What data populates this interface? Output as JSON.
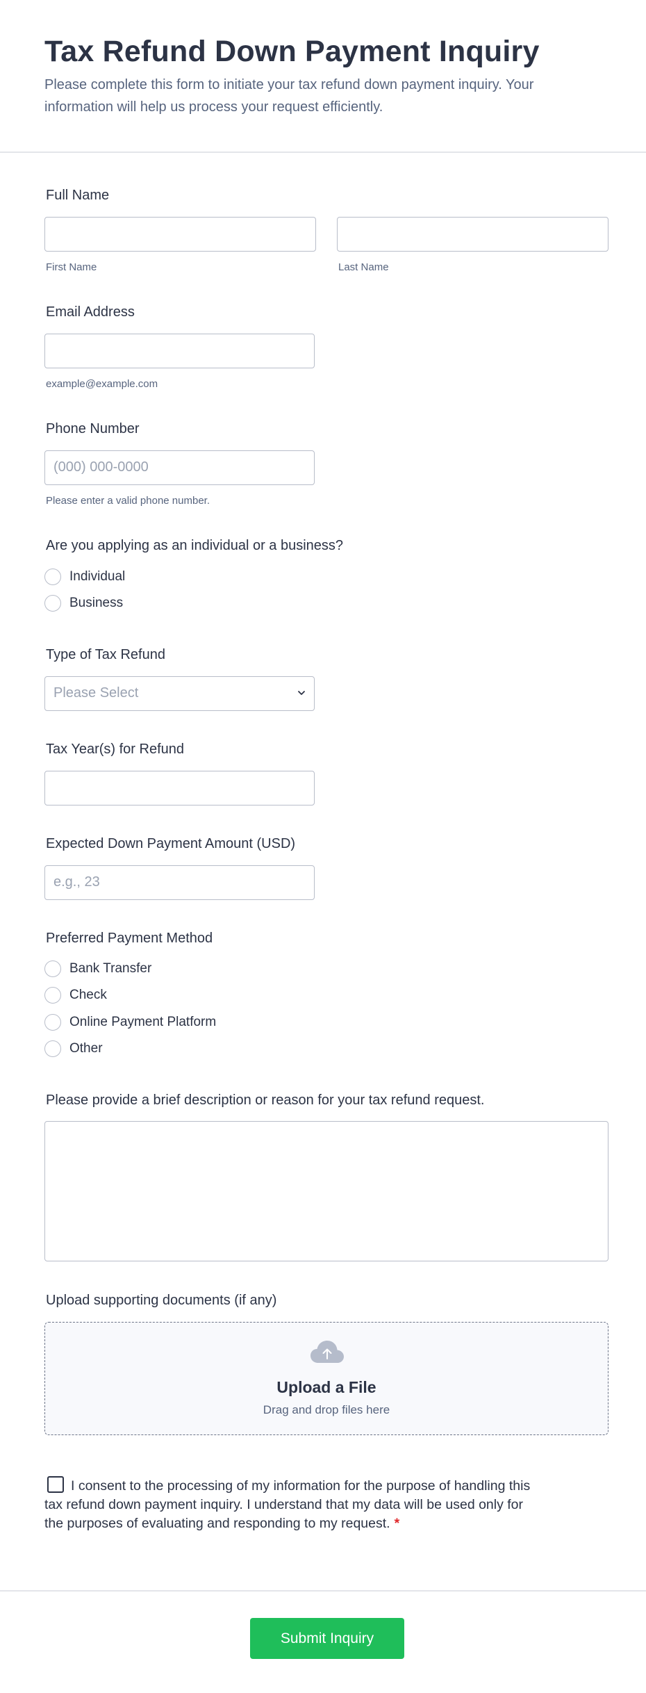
{
  "header": {
    "title": "Tax Refund Down Payment Inquiry",
    "description": "Please complete this form to initiate your tax refund down payment inquiry. Your information will help us process your request efficiently."
  },
  "full_name": {
    "label": "Full Name",
    "first_sublabel": "First Name",
    "last_sublabel": "Last Name",
    "first_value": "",
    "last_value": ""
  },
  "email": {
    "label": "Email Address",
    "value": "",
    "sublabel": "example@example.com"
  },
  "phone": {
    "label": "Phone Number",
    "placeholder": "(000) 000-0000",
    "sublabel": "Please enter a valid phone number."
  },
  "applicant_type": {
    "label": "Are you applying as an individual or a business?",
    "options": [
      "Individual",
      "Business"
    ]
  },
  "refund_type": {
    "label": "Type of Tax Refund",
    "selected": "Please Select",
    "icon": "chevron-down-icon"
  },
  "tax_years": {
    "label": "Tax Year(s) for Refund",
    "value": ""
  },
  "down_payment": {
    "label": "Expected Down Payment Amount (USD)",
    "placeholder": "e.g., 23"
  },
  "payment_method": {
    "label": "Preferred Payment Method",
    "options": [
      "Bank Transfer",
      "Check",
      "Online Payment Platform",
      "Other"
    ]
  },
  "description": {
    "label": "Please provide a brief description or reason for your tax refund request.",
    "value": ""
  },
  "upload": {
    "label": "Upload supporting documents (if any)",
    "title": "Upload a File",
    "hint": "Drag and drop files here",
    "icon": "cloud-upload-icon"
  },
  "consent": {
    "text": "I consent to the processing of my information for the purpose of handling this tax refund down payment inquiry. I understand that my data will be used only for the purposes of evaluating and responding to my request.",
    "required_mark": "*"
  },
  "submit": {
    "label": "Submit Inquiry"
  },
  "colors": {
    "text": "#2c3345",
    "muted": "#57647e",
    "border": "#b8bdc9",
    "submit_bg": "#1fbe5a",
    "required": "#e0282b"
  }
}
